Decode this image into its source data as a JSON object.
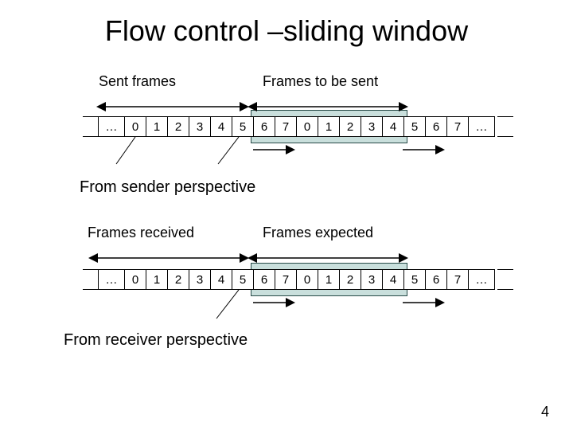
{
  "title": "Flow control –sliding window",
  "page_number": "4",
  "sender": {
    "label_sent": "Sent frames",
    "label_to_send": "Frames to be sent",
    "caption": "From sender perspective",
    "cells": [
      "…",
      "0",
      "1",
      "2",
      "3",
      "4",
      "5",
      "6",
      "7",
      "0",
      "1",
      "2",
      "3",
      "4",
      "5",
      "6",
      "7",
      "…"
    ],
    "window_start_index": 7,
    "window_len": 7
  },
  "receiver": {
    "label_recv": "Frames received",
    "label_exp": "Frames expected",
    "caption": "From receiver perspective",
    "cells": [
      "…",
      "0",
      "1",
      "2",
      "3",
      "4",
      "5",
      "6",
      "7",
      "0",
      "1",
      "2",
      "3",
      "4",
      "5",
      "6",
      "7",
      "…"
    ],
    "window_start_index": 7,
    "window_len": 7
  }
}
